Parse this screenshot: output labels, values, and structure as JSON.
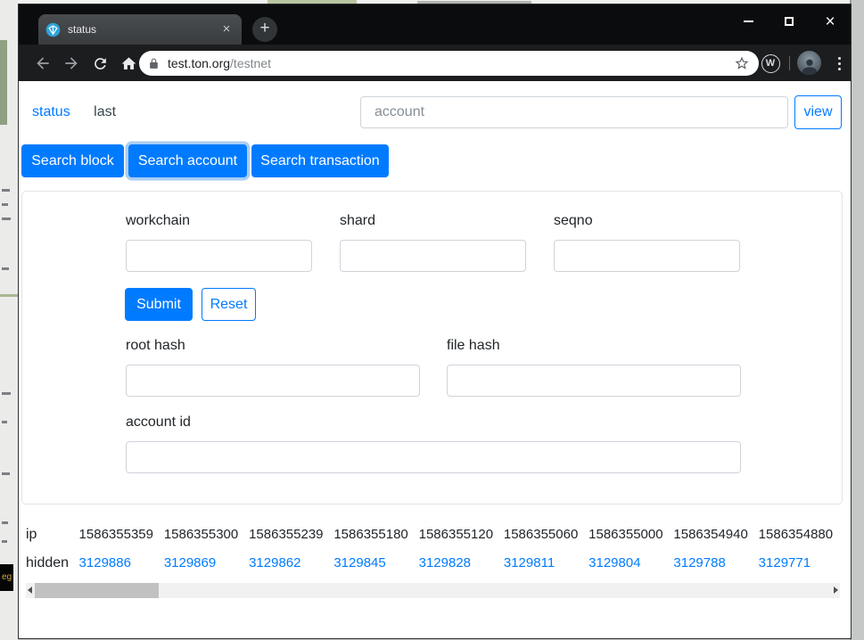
{
  "colors": {
    "accent_blue": "#007bff",
    "chrome_dark": "#0b0c0d",
    "toolbar_dark": "#1c1d1f",
    "tab_gray": "#45484b",
    "favicon_blue": "#2da4dc",
    "link_blue": "#007bff",
    "scrollbar_thumb": "#c1c1c1"
  },
  "browser": {
    "tab": {
      "title": "status",
      "close_glyph": "×",
      "new_tab_glyph": "+"
    },
    "window_controls": {
      "close_glyph": "×"
    },
    "url": {
      "domain": "test.ton.org",
      "path": "/testnet"
    },
    "extension_letter": "W",
    "icons": {
      "favicon": "ton-diamond",
      "back": "arrow-left",
      "forward": "arrow-right",
      "reload": "refresh",
      "home": "house",
      "lock": "padlock",
      "star": "star-outline",
      "extension": "w-in-circle",
      "avatar": "profile-photo",
      "menu": "three-dots-vertical"
    }
  },
  "page": {
    "nav": {
      "status_label": "status",
      "last_label": "last"
    },
    "account_bar": {
      "input_placeholder": "account",
      "view_button_label": "view"
    },
    "search_buttons": {
      "block": "Search block",
      "account": "Search account",
      "transaction": "Search transaction"
    },
    "form": {
      "workchain_label": "workchain",
      "shard_label": "shard",
      "seqno_label": "seqno",
      "submit_label": "Submit",
      "reset_label": "Reset",
      "root_hash_label": "root hash",
      "file_hash_label": "file hash",
      "account_id_label": "account id"
    },
    "table": {
      "ip_label": "ip",
      "hidden_label": "hidden",
      "ip_values": [
        "1586355359",
        "1586355300",
        "1586355239",
        "1586355180",
        "1586355120",
        "1586355060",
        "1586355000",
        "1586354940",
        "1586354880"
      ],
      "hidden_values": [
        "3129886",
        "3129869",
        "3129862",
        "3129845",
        "3129828",
        "3129811",
        "3129804",
        "3129788",
        "3129771"
      ]
    }
  },
  "background": {
    "badge_text": "eg"
  }
}
